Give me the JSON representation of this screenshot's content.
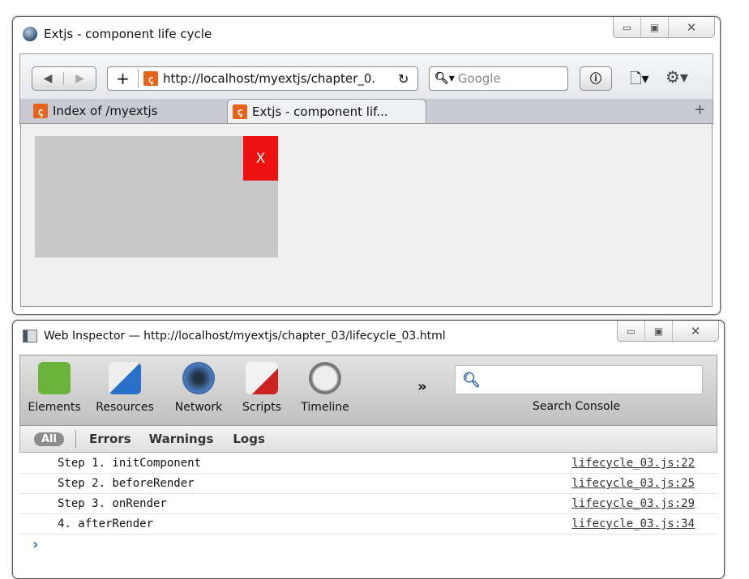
{
  "browser": {
    "title": "Extjs - component life cycle",
    "url": "http://localhost/myextjs/chapter_0.",
    "search_placeholder": "Google",
    "tabs": [
      {
        "label": "Index of /myextjs"
      },
      {
        "label": "Extjs - component lif..."
      }
    ],
    "new_tab": "+",
    "close_button_label": "X"
  },
  "inspector": {
    "title": "Web Inspector — http://localhost/myextjs/chapter_03/lifecycle_03.html",
    "tools": [
      {
        "label": "Elements"
      },
      {
        "label": "Resources"
      },
      {
        "label": "Network"
      },
      {
        "label": "Scripts"
      },
      {
        "label": "Timeline"
      }
    ],
    "more": "»",
    "search_label": "Search Console",
    "filters": [
      {
        "label": "All",
        "active": true
      },
      {
        "label": "Errors"
      },
      {
        "label": "Warnings"
      },
      {
        "label": "Logs"
      }
    ],
    "messages": [
      {
        "text": "Step 1. initComponent",
        "source": "lifecycle_03.js:22"
      },
      {
        "text": "Step 2. beforeRender",
        "source": "lifecycle_03.js:25"
      },
      {
        "text": "Step 3. onRender",
        "source": "lifecycle_03.js:29"
      },
      {
        "text": "4. afterRender",
        "source": "lifecycle_03.js:34"
      }
    ],
    "prompt": "›"
  },
  "colors": {
    "close_button": "#ee1111",
    "component_box": "#c8c8c8"
  }
}
